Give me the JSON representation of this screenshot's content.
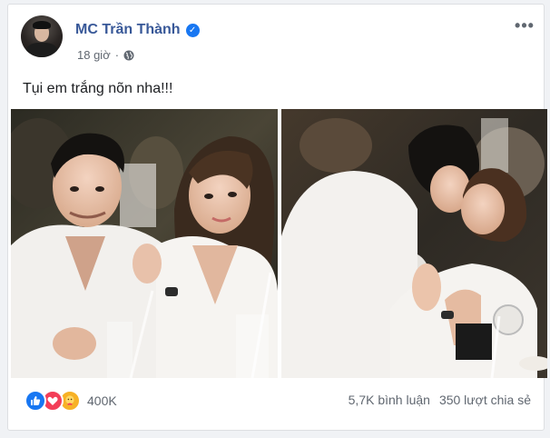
{
  "post": {
    "author": "MC Trần Thành",
    "time": "18 giờ",
    "separator": "·",
    "text": "Tụi em trắng nõn nha!!!",
    "more_label": "•••"
  },
  "photos": [
    {
      "icon": "couple-photo-left"
    },
    {
      "icon": "couple-photo-right"
    }
  ],
  "reactions": {
    "icons": [
      "like-icon",
      "love-icon",
      "care-icon"
    ],
    "count": "400K",
    "comments": "5,7K bình luận",
    "shares": "350 lượt chia sẻ"
  },
  "colors": {
    "author_name": "#385898",
    "verified": "#1877f2",
    "like": "#1877f2",
    "love": "#f33e58",
    "care": "#f7b125",
    "meta_text": "#606770"
  }
}
